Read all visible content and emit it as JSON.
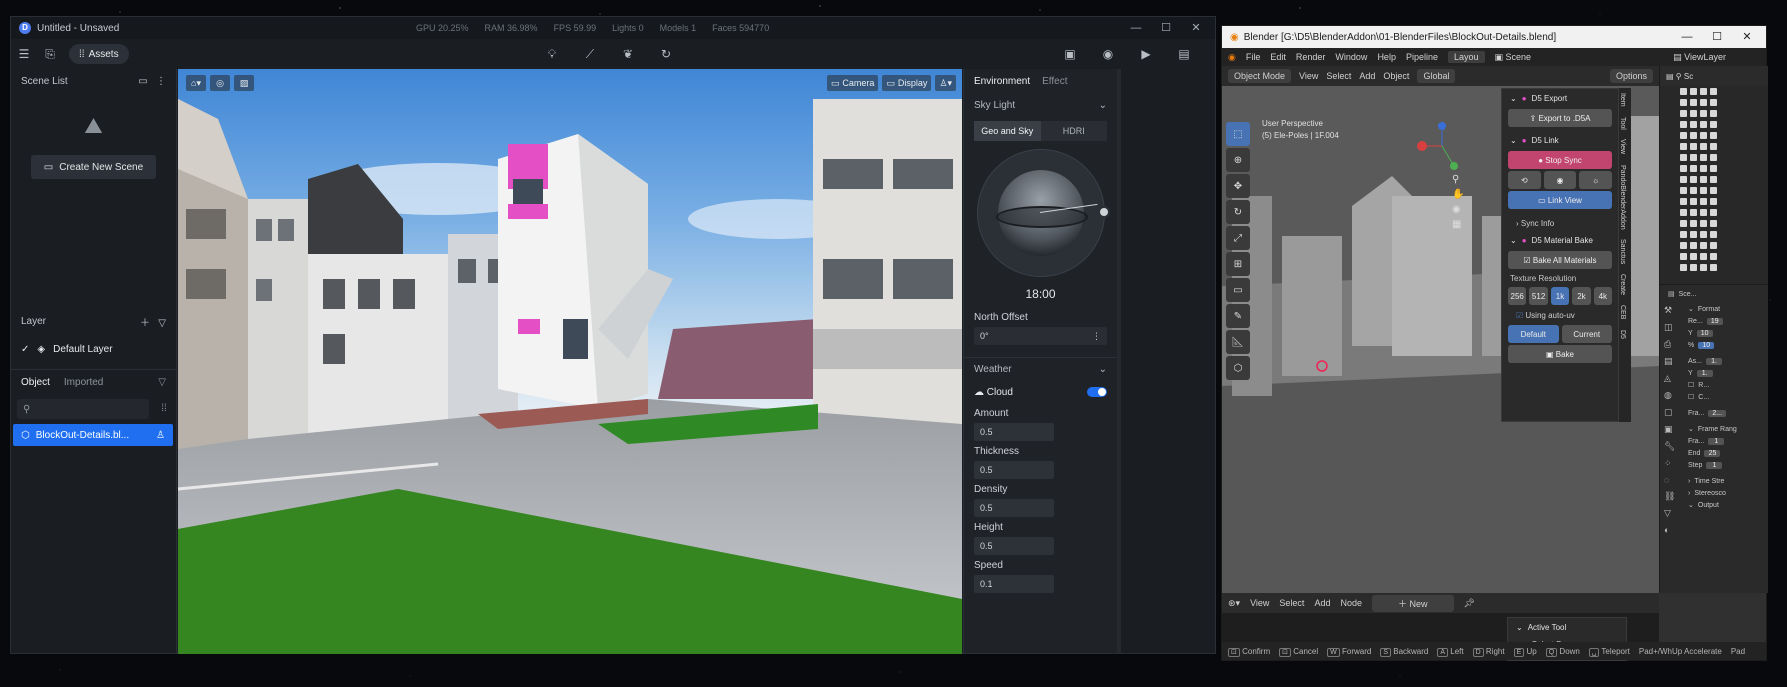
{
  "d5": {
    "title": "Untitled - Unsaved",
    "stats": {
      "gpu": "GPU 20.25%",
      "ram": "RAM 36.98%",
      "fps": "FPS 59.99",
      "lights": "Lights 0",
      "models": "Models 1",
      "faces": "Faces 594770"
    },
    "toolbar": {
      "assets_label": "Assets"
    },
    "left": {
      "scene_list_label": "Scene List",
      "create_scene_label": "Create New Scene",
      "layer_label": "Layer",
      "default_layer": "Default Layer",
      "tab_object": "Object",
      "tab_imported": "Imported",
      "object_item": "BlockOut-Details.bl..."
    },
    "viewport": {
      "camera_label": "Camera",
      "display_label": "Display"
    },
    "right": {
      "tab_environment": "Environment",
      "tab_effect": "Effect",
      "sky_light": "Sky Light",
      "seg_geo": "Geo and Sky",
      "seg_hdri": "HDRI",
      "time": "18:00",
      "north_offset_label": "North Offset",
      "north_offset_value": "0°",
      "weather_label": "Weather",
      "cloud_label": "Cloud",
      "amount_label": "Amount",
      "amount_value": "0.5",
      "thickness_label": "Thickness",
      "thickness_value": "0.5",
      "density_label": "Density",
      "density_value": "0.5",
      "height_label": "Height",
      "height_value": "0.5",
      "speed_label": "Speed",
      "speed_value": "0.1"
    }
  },
  "blender": {
    "title": "Blender [G:\\D5\\BlenderAddon\\01-BlenderFiles\\BlockOut-Details.blend]",
    "menu": [
      "File",
      "Edit",
      "Render",
      "Window",
      "Help",
      "Pipeline"
    ],
    "workspace_tab": "Layou",
    "scene_label": "Scene",
    "viewlayer_label": "ViewLayer",
    "vp_header": {
      "mode": "Object Mode",
      "view": "View",
      "select": "Select",
      "add": "Add",
      "object": "Object",
      "orientation": "Global",
      "options": "Options"
    },
    "vp_text": {
      "line1": "User Perspective",
      "line2": "(5) Ele-Poles | 1F.004"
    },
    "npanel": {
      "export_head": "D5 Export",
      "export_btn": "Export to .D5A",
      "link_head": "D5 Link",
      "stop_sync": "Stop Sync",
      "link_view": "Link View",
      "sync_info": "Sync Info",
      "bake_head": "D5 Material Bake",
      "bake_all": "Bake All Materials",
      "tex_res": "Texture Resolution",
      "res": [
        "256",
        "512",
        "1k",
        "2k",
        "4k"
      ],
      "using_auto_uv": "Using auto-uv",
      "default": "Default",
      "current": "Current",
      "bake": "Bake"
    },
    "ntabs": [
      "Item",
      "Tool",
      "View",
      "PandoBlenderAddon",
      "Sanctus",
      "Create",
      "CEB",
      "D5"
    ],
    "outliner_head": "Sc",
    "props": {
      "scene": "Sce...",
      "format": "Format",
      "res_label": "Re...",
      "res_x": "19",
      "res_y_label": "Y",
      "res_y": "10",
      "pct_label": "%",
      "pct": "10",
      "aspect_label": "As...",
      "aspect_x": "1.",
      "aspect_y_label": "Y",
      "aspect_y": "1.",
      "r_label": "R...",
      "c_label": "C...",
      "fra_label": "Fra...",
      "fra_val": "2...",
      "frame_range": "Frame Rang",
      "frame_start_label": "Fra...",
      "frame_start": "1",
      "end_label": "End",
      "end": "25",
      "step_label": "Step",
      "step": "1",
      "time_stretch": "Time Stre",
      "stereoscopy": "Stereosco",
      "output": "Output"
    },
    "node_header": {
      "view": "View",
      "select": "Select",
      "add": "Add",
      "node": "Node",
      "new": "New"
    },
    "active_tool": "Active Tool",
    "select_box": "Select Box",
    "status": [
      "Confirm",
      "Cancel",
      "Forward",
      "Backward",
      "Left",
      "Right",
      "Up",
      "Down",
      "Teleport",
      "Pad+/WhUp Accelerate",
      "Pad"
    ]
  }
}
